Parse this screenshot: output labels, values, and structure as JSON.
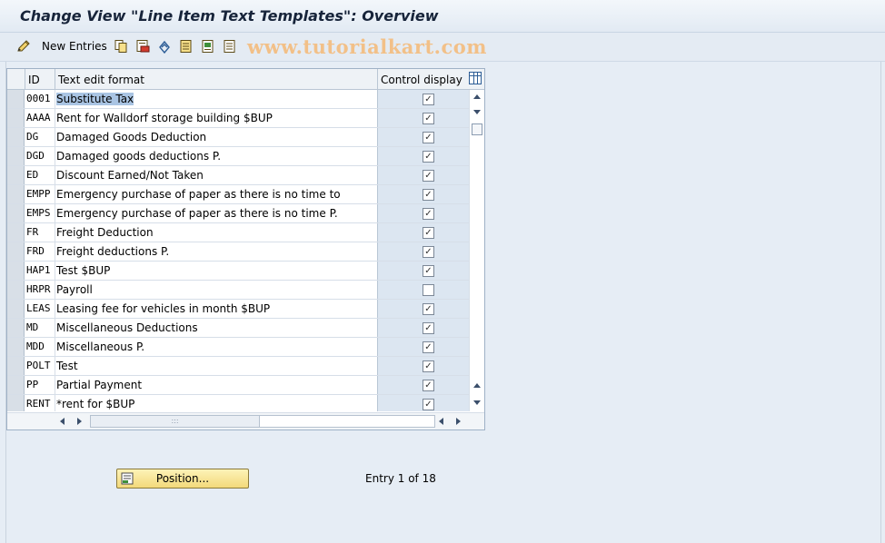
{
  "window": {
    "title": "Change View \"Line Item Text Templates\": Overview"
  },
  "toolbar": {
    "new_entries_label": "New Entries",
    "icons": [
      "edit-pencil-icon",
      "copy-icon",
      "delete-icon",
      "undo-icon",
      "select-all-icon",
      "select-block-icon",
      "deselect-all-icon"
    ]
  },
  "watermark": "www.tutorialkart.com",
  "table": {
    "headers": {
      "id": "ID",
      "text": "Text edit format",
      "control": "Control display"
    },
    "rows": [
      {
        "id": "0001",
        "text": "Substitute Tax",
        "checked": true
      },
      {
        "id": "AAAA",
        "text": "Rent for Walldorf storage building $BUP",
        "checked": true
      },
      {
        "id": "DG",
        "text": "Damaged Goods Deduction",
        "checked": true
      },
      {
        "id": "DGD",
        "text": "Damaged goods deductions P.",
        "checked": true
      },
      {
        "id": "ED",
        "text": "Discount Earned/Not Taken",
        "checked": true
      },
      {
        "id": "EMPP",
        "text": "Emergency purchase of paper as there is no time to",
        "checked": true
      },
      {
        "id": "EMPS",
        "text": "Emergency purchase of paper as there is no time P.",
        "checked": true
      },
      {
        "id": "FR",
        "text": "Freight Deduction",
        "checked": true
      },
      {
        "id": "FRD",
        "text": "Freight deductions P.",
        "checked": true
      },
      {
        "id": "HAP1",
        "text": "Test $BUP",
        "checked": true
      },
      {
        "id": "HRPR",
        "text": "Payroll",
        "checked": false
      },
      {
        "id": "LEAS",
        "text": "Leasing fee for vehicles in month $BUP",
        "checked": true
      },
      {
        "id": "MD",
        "text": "Miscellaneous Deductions",
        "checked": true
      },
      {
        "id": "MDD",
        "text": "Miscellaneous P.",
        "checked": true
      },
      {
        "id": "POLT",
        "text": "Test",
        "checked": true
      },
      {
        "id": "PP",
        "text": "Partial Payment",
        "checked": true
      },
      {
        "id": "RENT",
        "text": "*rent for $BUP",
        "checked": true
      }
    ],
    "check_glyph": "✓",
    "hscroll_grip": ":::"
  },
  "position_button": {
    "label": "Position..."
  },
  "entry_info": "Entry 1 of 18",
  "colors": {
    "background": "#e6edf5",
    "selection": "#a9c4e3",
    "button": "#f3d97a",
    "watermark": "#f2c088"
  }
}
